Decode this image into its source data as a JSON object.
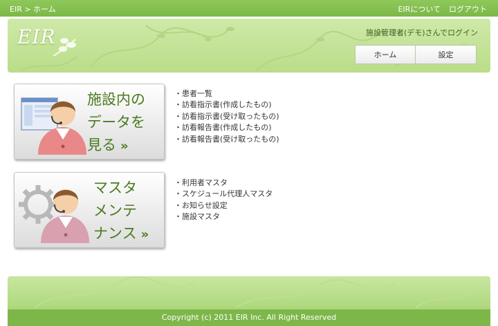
{
  "topbar": {
    "breadcrumb": "EIR > ホーム",
    "links": [
      "EIRについて",
      "ログアウト"
    ]
  },
  "header": {
    "logo": "EIR",
    "login_message": "施設管理者(デモ)さんでログイン",
    "nav": [
      "ホーム",
      "設定"
    ]
  },
  "menu1": {
    "lines": [
      "施設内の",
      "データを",
      "見る"
    ],
    "items": [
      "患者一覧",
      "訪看指示書(作成したもの)",
      "訪看指示書(受け取ったもの)",
      "訪看報告書(作成したもの)",
      "訪看報告書(受け取ったもの)"
    ]
  },
  "menu2": {
    "lines": [
      "マスタ",
      "メンテ",
      "ナンス"
    ],
    "items": [
      "利用者マスタ",
      "スケジュール代理人マスタ",
      "お知らせ設定",
      "施設マスタ"
    ]
  },
  "footer": {
    "copyright": "Copyright (c) 2011 EIR Inc. All Right Reserved"
  },
  "colors": {
    "accent": "#7ab848",
    "text_green": "#4a7a1e",
    "header_bg": "#c4e398"
  },
  "icons": [
    "person-icon",
    "screen-icon",
    "gear-icon",
    "chevron-right-icon"
  ]
}
